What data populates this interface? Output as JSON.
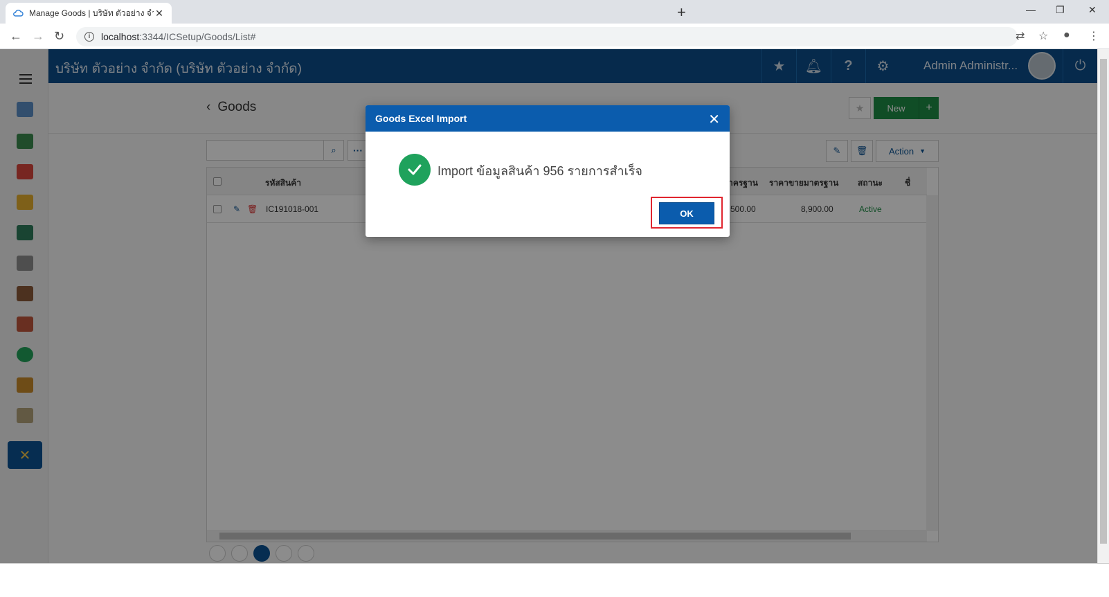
{
  "browser": {
    "tab_title": "Manage Goods | บริษัท ตัวอย่าง จำกั",
    "tab_close": "✕",
    "new_tab": "+",
    "url_host": "localhost",
    "url_rest": ":3344/ICSetup/Goods/List#",
    "min": "—",
    "restore": "❐",
    "close": "✕"
  },
  "header": {
    "company": "บริษัท ตัวอย่าง จำกัด (บริษัท ตัวอย่าง จำกัด)",
    "user_name": "Admin Administr..."
  },
  "page": {
    "title": "Goods",
    "back": "‹",
    "new_label": "New",
    "new_plus": "+",
    "action_label": "Action"
  },
  "grid": {
    "columns": [
      "รหัสสินค้า",
      "อมาครฐาน",
      "ราคาขายมาตรฐาน",
      "สถานะ",
      "ชื่"
    ],
    "rows": [
      {
        "code": "IC191018-001",
        "cost": "6,500.00",
        "price": "8,900.00",
        "status": "Active"
      }
    ]
  },
  "modal": {
    "title": "Goods Excel Import",
    "close": "✕",
    "message": "Import ข้อมูลสินค้า 956 รายการสำเร็จ",
    "ok_label": "OK"
  },
  "colors": {
    "header_bg": "#0b4e8a",
    "modal_head": "#0b5cad",
    "success": "#1fa25c",
    "active_status": "#1e8c45",
    "highlight": "#e0252f"
  }
}
